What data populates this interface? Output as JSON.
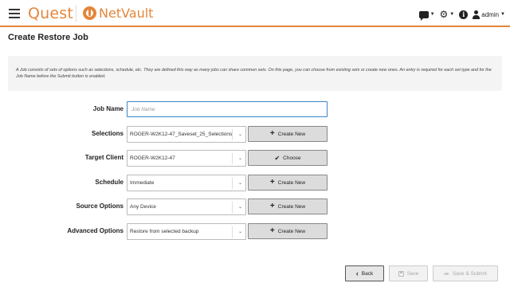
{
  "header": {
    "brand": "Quest",
    "product": "NetVault",
    "user": "admin"
  },
  "page": {
    "title": "Create Restore Job",
    "info": "A Job consists of sets of options such as selections, schedule, etc. They are defined this way as many jobs can share common sets. On this page, you can choose from existing sets or create new ones. An entry is required for each set type and for the Job Name before the Submit button is enabled."
  },
  "form": {
    "job_name": {
      "label": "Job Name",
      "placeholder": "Job Name",
      "value": ""
    },
    "selections": {
      "label": "Selections",
      "value": "ROGER-W2K12-47_Saveset_25_Selections",
      "button": "Create New"
    },
    "target_client": {
      "label": "Target Client",
      "value": "ROGER-W2K12-47",
      "button": "Choose"
    },
    "schedule": {
      "label": "Schedule",
      "value": "Immediate",
      "button": "Create New"
    },
    "source_options": {
      "label": "Source Options",
      "value": "Any Device",
      "button": "Create New"
    },
    "advanced_options": {
      "label": "Advanced Options",
      "value": "Restore from selected backup",
      "button": "Create New"
    }
  },
  "footer": {
    "back": "Back",
    "save": "Save",
    "save_submit": "Save & Submit"
  },
  "colors": {
    "accent": "#e4863a",
    "input_focus": "#3b86c4"
  }
}
